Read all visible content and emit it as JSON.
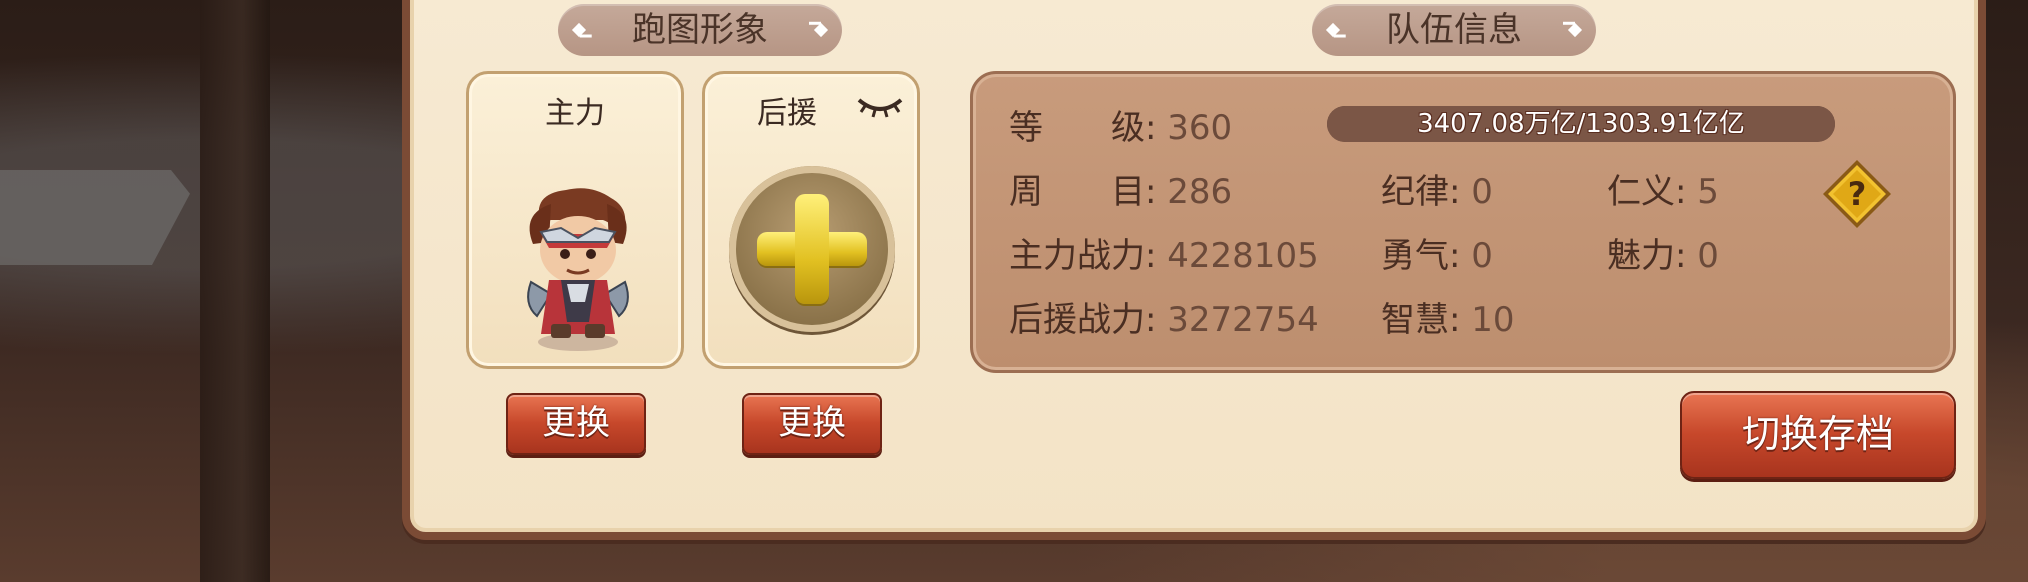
{
  "titles": {
    "appearance": "跑图形象",
    "team_info": "队伍信息"
  },
  "cards": {
    "main_label": "主力",
    "support_label": "后援"
  },
  "buttons": {
    "change_main": "更换",
    "change_support": "更换",
    "switch_save": "切换存档"
  },
  "team": {
    "level_label": "等　　级:",
    "level_value": "360",
    "exp_text": "3407.08万亿/1303.91亿亿",
    "exp_fraction": 1.0,
    "cycle_label": "周　　目:",
    "cycle_value": "286",
    "discipline_label": "纪律:",
    "discipline_value": "0",
    "benevolence_label": "仁义:",
    "benevolence_value": "5",
    "main_power_label": "主力战力:",
    "main_power_value": "4228105",
    "courage_label": "勇气:",
    "courage_value": "0",
    "charm_label": "魅力:",
    "charm_value": "0",
    "support_power_label": "后援战力:",
    "support_power_value": "3272754",
    "wisdom_label": "智慧:",
    "wisdom_value": "10"
  },
  "icons": {
    "help": "question-diamond-icon",
    "eye": "closed-eye-icon",
    "add": "plus-icon"
  },
  "colors": {
    "panel_bg": "#f5e6cb",
    "info_bg": "#c4957a",
    "button_red": "#c7482b",
    "plus_yellow": "#e2c122"
  }
}
